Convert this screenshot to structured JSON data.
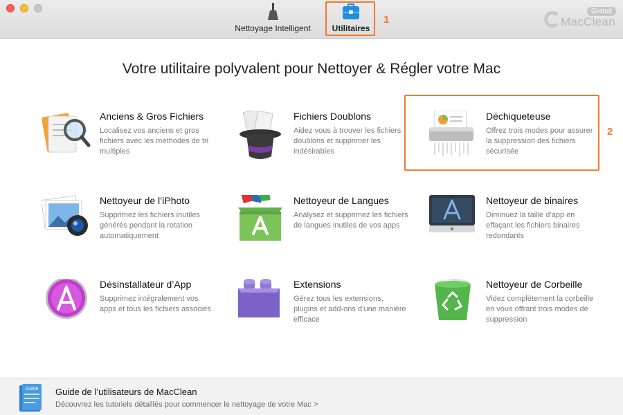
{
  "toolbar": {
    "tabs": [
      {
        "label": "Nettoyage Intelligent",
        "icon": "broom-icon"
      },
      {
        "label": "Utilitaires",
        "icon": "briefcase-icon",
        "selected": true
      }
    ],
    "brand": {
      "badge": "Gratuit",
      "name": "MacClean"
    },
    "markers": [
      "1",
      "2"
    ]
  },
  "main": {
    "headline": "Votre utilitaire polyvalent pour Nettoyer & Régler votre Mac",
    "tools": [
      {
        "title": "Anciens & Gros Fichiers",
        "desc": "Localisez vos anciens et gros fichiers avec les méthodes de tri multiples",
        "icon": "magnifier-files-icon"
      },
      {
        "title": "Fichiers Doublons",
        "desc": "Aidez vous à trouver les fichiers doublons et supprimer les indésirables",
        "icon": "magic-hat-icon"
      },
      {
        "title": "Déchiqueteuse",
        "desc": "Offrez trois modes pour assurer la suppression des fichiers sécurisée",
        "icon": "shredder-icon"
      },
      {
        "title": "Nettoyeur de l’iPhoto",
        "desc": "Supprimez les fichiers inutiles générés pendant la rotation automatiquement",
        "icon": "iphoto-icon"
      },
      {
        "title": "Nettoyeur de Langues",
        "desc": "Analysez et supprimez les fichiers de langues inutiles de vos apps",
        "icon": "language-box-icon"
      },
      {
        "title": "Nettoyeur de binaires",
        "desc": "Diminuez la taille d’app en effaçant les fichiers binaires redondants",
        "icon": "binary-display-icon"
      },
      {
        "title": "Désinstallateur d’App",
        "desc": "Supprimez intégralement vos apps et tous les fichiers associés",
        "icon": "app-store-icon"
      },
      {
        "title": "Extensions",
        "desc": "Gérez tous les extensions, plugins et add-ons d’une manière efficace",
        "icon": "lego-brick-icon"
      },
      {
        "title": "Nettoyeur de Corbeille",
        "desc": "Videz complètement la corbeille en vous offrant trois modes de suppression",
        "icon": "trash-bin-icon"
      }
    ]
  },
  "footer": {
    "icon_label": "Guide",
    "title": "Guide de l’utilisateurs de MacClean",
    "desc": "Découvrez les tutoriels détaillés pour commencer le nettoyage de votre Mac >"
  },
  "colors": {
    "accent": "#f2792f",
    "tab_blue": "#1f8fe0"
  }
}
